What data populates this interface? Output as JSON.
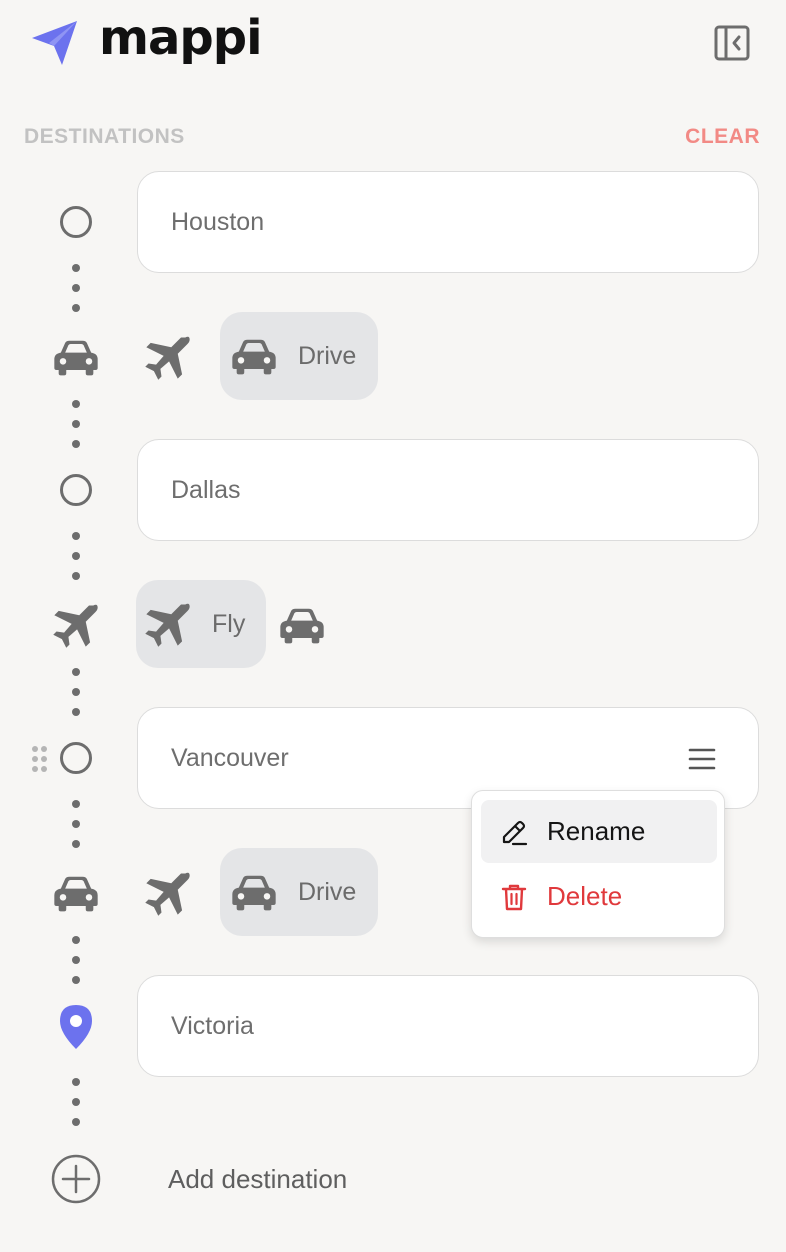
{
  "header": {
    "app_name": "mappi",
    "logo_icon": "paper-plane-icon",
    "brand_color": "#6c72ee",
    "collapse_icon": "sidebar-collapse-icon"
  },
  "destinations_section": {
    "label": "DESTINATIONS",
    "clear_label": "CLEAR",
    "clear_color": "#f28a85"
  },
  "destinations": [
    {
      "name": "Houston",
      "marker": "circle"
    },
    {
      "name": "Dallas",
      "marker": "circle"
    },
    {
      "name": "Vancouver",
      "marker": "circle"
    },
    {
      "name": "Victoria",
      "marker": "location-pin",
      "marker_color": "#6c72ee"
    }
  ],
  "legs": [
    {
      "selected_mode": "Drive",
      "options": [
        "Fly",
        "Drive"
      ]
    },
    {
      "selected_mode": "Fly",
      "options": [
        "Fly",
        "Drive"
      ]
    },
    {
      "selected_mode": "Drive",
      "options": [
        "Fly",
        "Drive"
      ]
    }
  ],
  "context_menu": {
    "items": [
      {
        "label": "Rename",
        "icon": "pencil-icon",
        "hovered": true
      },
      {
        "label": "Delete",
        "icon": "trash-icon",
        "color": "#e0393c"
      }
    ]
  },
  "add_destination": {
    "label": "Add destination",
    "icon": "plus-circle-icon"
  }
}
